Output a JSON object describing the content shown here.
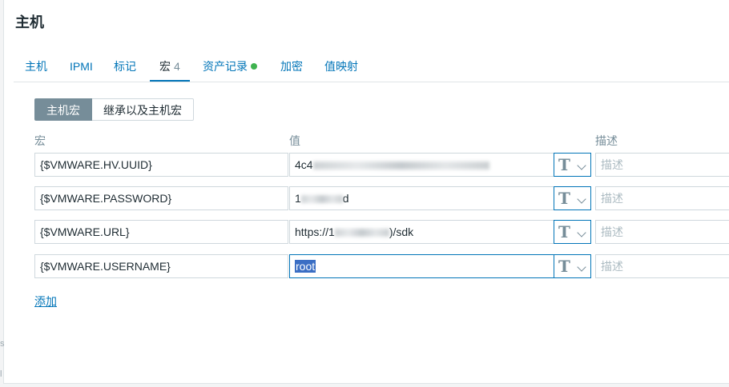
{
  "dialog": {
    "title": "主机"
  },
  "tabs": [
    {
      "label": "主机"
    },
    {
      "label": "IPMI"
    },
    {
      "label": "标记"
    },
    {
      "label": "宏",
      "count": "4"
    },
    {
      "label": "资产记录"
    },
    {
      "label": "加密"
    },
    {
      "label": "值映射"
    }
  ],
  "macro_scope": {
    "host_macros": "主机宏",
    "inherited": "继承以及主机宏"
  },
  "columns": {
    "macro": "宏",
    "value": "值",
    "description": "描述"
  },
  "rows": [
    {
      "macro": "{$VMWARE.HV.UUID}",
      "value_prefix": "4c4",
      "value_suffix": "",
      "type_glyph": "T",
      "description_placeholder": "描述"
    },
    {
      "macro": "{$VMWARE.PASSWORD}",
      "value_prefix": "1",
      "value_suffix": "d",
      "type_glyph": "T",
      "description_placeholder": "描述"
    },
    {
      "macro": "{$VMWARE.URL}",
      "value_prefix": "https://1",
      "value_suffix": ")/sdk",
      "type_glyph": "T",
      "description_placeholder": "描述"
    },
    {
      "macro": "{$VMWARE.USERNAME}",
      "value_prefix": "root",
      "value_suffix": "",
      "type_glyph": "T",
      "description_placeholder": "描述"
    }
  ],
  "add_link": "添加",
  "edge_glyphs": {
    "s": "s",
    "l": "l"
  },
  "colors": {
    "link": "#0275b8",
    "status_green": "#3fb34f",
    "selection": "#3a6ec4"
  }
}
